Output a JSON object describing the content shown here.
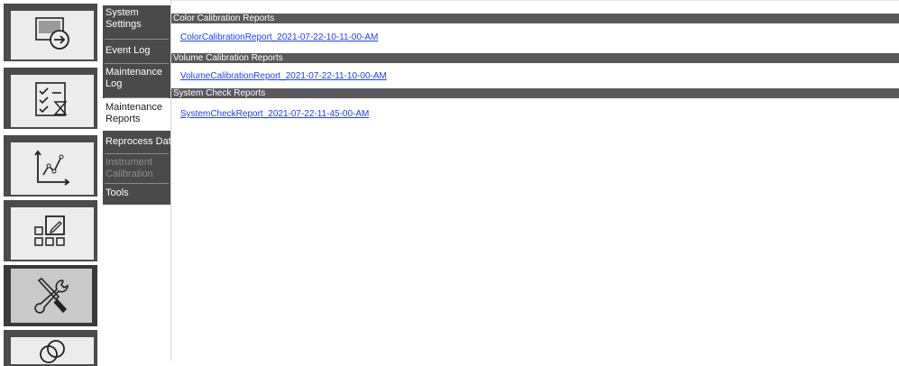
{
  "rail": {
    "items": [
      {
        "name": "import-export",
        "icon": "screen-arrow-icon",
        "selected": false
      },
      {
        "name": "checklist",
        "icon": "checklist-hourglass-icon",
        "selected": false
      },
      {
        "name": "analytics",
        "icon": "line-chart-icon",
        "selected": false
      },
      {
        "name": "layout-editor",
        "icon": "grid-edit-icon",
        "selected": false
      },
      {
        "name": "tools",
        "icon": "wrench-screwdriver-icon",
        "selected": true
      },
      {
        "name": "more",
        "icon": "circles-icon",
        "selected": false
      }
    ]
  },
  "submenu": {
    "items": [
      {
        "label": "System Settings",
        "state": "normal"
      },
      {
        "label": "Event Log",
        "state": "normal"
      },
      {
        "label": "Maintenance Log",
        "state": "normal"
      },
      {
        "label": "Maintenance Reports",
        "state": "active"
      },
      {
        "label": "Reprocess Data",
        "state": "normal"
      },
      {
        "label": "Instrument Calibration",
        "state": "disabled"
      },
      {
        "label": "Tools",
        "state": "normal"
      }
    ]
  },
  "sections": [
    {
      "title": "Color Calibration Reports",
      "links": [
        "ColorCalibrationReport_2021-07-22-10-11-00-AM"
      ]
    },
    {
      "title": "Volume Calibration Reports",
      "links": [
        "VolumeCalibrationReport_2021-07-22-11-10-00-AM"
      ]
    },
    {
      "title": "System Check Reports",
      "links": [
        "SystemCheckReport_2021-07-22-11-45-00-AM"
      ]
    }
  ],
  "colors": {
    "rail_tile": "#4b4b4b",
    "submenu_bg": "#4a4a4a",
    "section_bar": "#595959",
    "link": "#1a3eff"
  }
}
